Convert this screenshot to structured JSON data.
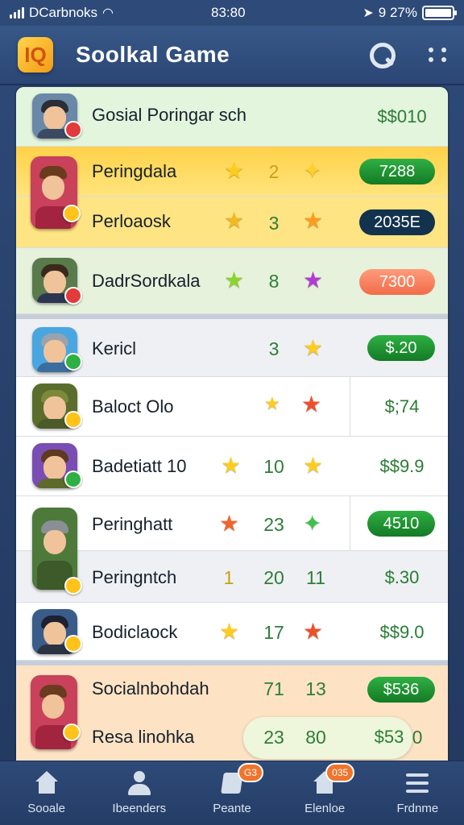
{
  "status_bar": {
    "carrier": "DCarbnoks",
    "time": "83:80",
    "battery": "9 27%"
  },
  "header": {
    "title": "Soolkal Game",
    "logo_glyph": "IQ"
  },
  "rows": [
    {
      "name": "Gosial Poringar sch",
      "value": "$$010"
    },
    {
      "name": "Peringdala",
      "n1": "2",
      "value": "7288"
    },
    {
      "name": "Perloaosk",
      "n1": "3",
      "value": "2035E"
    },
    {
      "name": "DadrSordkala",
      "n1": "8",
      "value": "7300"
    },
    {
      "name": "Kericl",
      "n1": "3",
      "value": "$.20"
    },
    {
      "name": "Baloct Olo",
      "value": "$;74"
    },
    {
      "name": "Badetiatt 10",
      "n1": "10",
      "value": "$$9.9"
    },
    {
      "name": "Peringhatt",
      "n1": "23",
      "value": "4510"
    },
    {
      "name": "Peringntch",
      "n0": "1",
      "n1": "20",
      "n2": "11",
      "value": "$.30"
    },
    {
      "name": "Bodiclaock",
      "n1": "17",
      "value": "$$9.0"
    },
    {
      "name": "Socialnbohdah",
      "n1": "71",
      "n2": "13",
      "value": "$536"
    },
    {
      "name": "Resa linohka",
      "n1": "23",
      "n2": "80",
      "value": "$53",
      "extra": "0"
    }
  ],
  "nav": [
    {
      "label": "Sooale",
      "icon": "home-icon"
    },
    {
      "label": "Ibeenders",
      "icon": "user-icon"
    },
    {
      "label": "Peante",
      "icon": "document-icon",
      "badge": "G3"
    },
    {
      "label": "Elenloe",
      "icon": "home-icon",
      "badge": "035"
    },
    {
      "label": "Frdnme",
      "icon": "menu-icon"
    }
  ],
  "colors": {
    "accent_green": "#1f8f2f",
    "header_blue": "#2e4a78",
    "gold": "#ffd149"
  }
}
